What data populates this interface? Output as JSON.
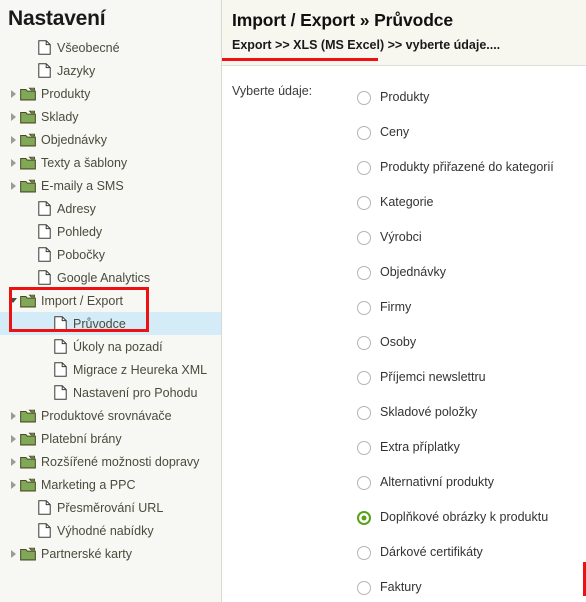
{
  "sidebar": {
    "title": "Nastavení",
    "items": [
      {
        "label": "Všeobecné",
        "icon": "file-icon",
        "level": 1,
        "arrow": "none",
        "selected": false
      },
      {
        "label": "Jazyky",
        "icon": "file-icon",
        "level": 1,
        "arrow": "none",
        "selected": false
      },
      {
        "label": "Produkty",
        "icon": "folder-icon",
        "level": 0,
        "arrow": "collapsed",
        "selected": false
      },
      {
        "label": "Sklady",
        "icon": "folder-icon",
        "level": 0,
        "arrow": "collapsed",
        "selected": false
      },
      {
        "label": "Objednávky",
        "icon": "folder-icon",
        "level": 0,
        "arrow": "collapsed",
        "selected": false
      },
      {
        "label": "Texty a šablony",
        "icon": "folder-icon",
        "level": 0,
        "arrow": "collapsed",
        "selected": false
      },
      {
        "label": "E-maily a SMS",
        "icon": "folder-icon",
        "level": 0,
        "arrow": "collapsed",
        "selected": false
      },
      {
        "label": "Adresy",
        "icon": "file-icon",
        "level": 1,
        "arrow": "none",
        "selected": false
      },
      {
        "label": "Pohledy",
        "icon": "file-icon",
        "level": 1,
        "arrow": "none",
        "selected": false
      },
      {
        "label": "Pobočky",
        "icon": "file-icon",
        "level": 1,
        "arrow": "none",
        "selected": false
      },
      {
        "label": "Google Analytics",
        "icon": "file-icon",
        "level": 1,
        "arrow": "none",
        "selected": false
      },
      {
        "label": "Import / Export",
        "icon": "folder-icon",
        "level": 0,
        "arrow": "expanded",
        "selected": false
      },
      {
        "label": "Průvodce",
        "icon": "file-icon",
        "level": 2,
        "arrow": "none",
        "selected": true
      },
      {
        "label": "Úkoly na pozadí",
        "icon": "file-icon",
        "level": 2,
        "arrow": "none",
        "selected": false
      },
      {
        "label": "Migrace z Heureka XML",
        "icon": "file-icon",
        "level": 2,
        "arrow": "none",
        "selected": false
      },
      {
        "label": "Nastavení pro Pohodu",
        "icon": "file-icon",
        "level": 2,
        "arrow": "none",
        "selected": false
      },
      {
        "label": "Produktové srovnávače",
        "icon": "folder-icon",
        "level": 0,
        "arrow": "collapsed",
        "selected": false
      },
      {
        "label": "Platební brány",
        "icon": "folder-icon",
        "level": 0,
        "arrow": "collapsed",
        "selected": false
      },
      {
        "label": "Rozšířené možnosti dopravy",
        "icon": "folder-icon",
        "level": 0,
        "arrow": "collapsed",
        "selected": false
      },
      {
        "label": "Marketing a PPC",
        "icon": "folder-icon",
        "level": 0,
        "arrow": "collapsed",
        "selected": false
      },
      {
        "label": "Přesměrování URL",
        "icon": "file-icon",
        "level": 1,
        "arrow": "none",
        "selected": false
      },
      {
        "label": "Výhodné nabídky",
        "icon": "file-icon",
        "level": 1,
        "arrow": "none",
        "selected": false
      },
      {
        "label": "Partnerské karty",
        "icon": "folder-icon",
        "level": 0,
        "arrow": "collapsed",
        "selected": false
      }
    ]
  },
  "header": {
    "title": "Import / Export » Průvodce",
    "breadcrumb": "Export >> XLS (MS Excel) >> vyberte údaje...."
  },
  "form": {
    "field_label": "Vyberte údaje:",
    "options": [
      {
        "label": "Produkty",
        "checked": false
      },
      {
        "label": "Ceny",
        "checked": false
      },
      {
        "label": "Produkty přiřazené do kategorií",
        "checked": false
      },
      {
        "label": "Kategorie",
        "checked": false
      },
      {
        "label": "Výrobci",
        "checked": false
      },
      {
        "label": "Objednávky",
        "checked": false
      },
      {
        "label": "Firmy",
        "checked": false
      },
      {
        "label": "Osoby",
        "checked": false
      },
      {
        "label": "Příjemci newslettru",
        "checked": false
      },
      {
        "label": "Skladové položky",
        "checked": false
      },
      {
        "label": "Extra příplatky",
        "checked": false
      },
      {
        "label": "Alternativní produkty",
        "checked": false
      },
      {
        "label": "Doplňkové obrázky k produktu",
        "checked": true
      },
      {
        "label": "Dárkové certifikáty",
        "checked": false
      },
      {
        "label": "Faktury",
        "checked": false
      }
    ]
  },
  "colors": {
    "annotation_red": "#ee1111",
    "radio_checked_green": "#5aa118",
    "selected_row_blue": "#d4ebf8",
    "folder_green": "#7fa857",
    "header_background": "#f8f7ef"
  }
}
